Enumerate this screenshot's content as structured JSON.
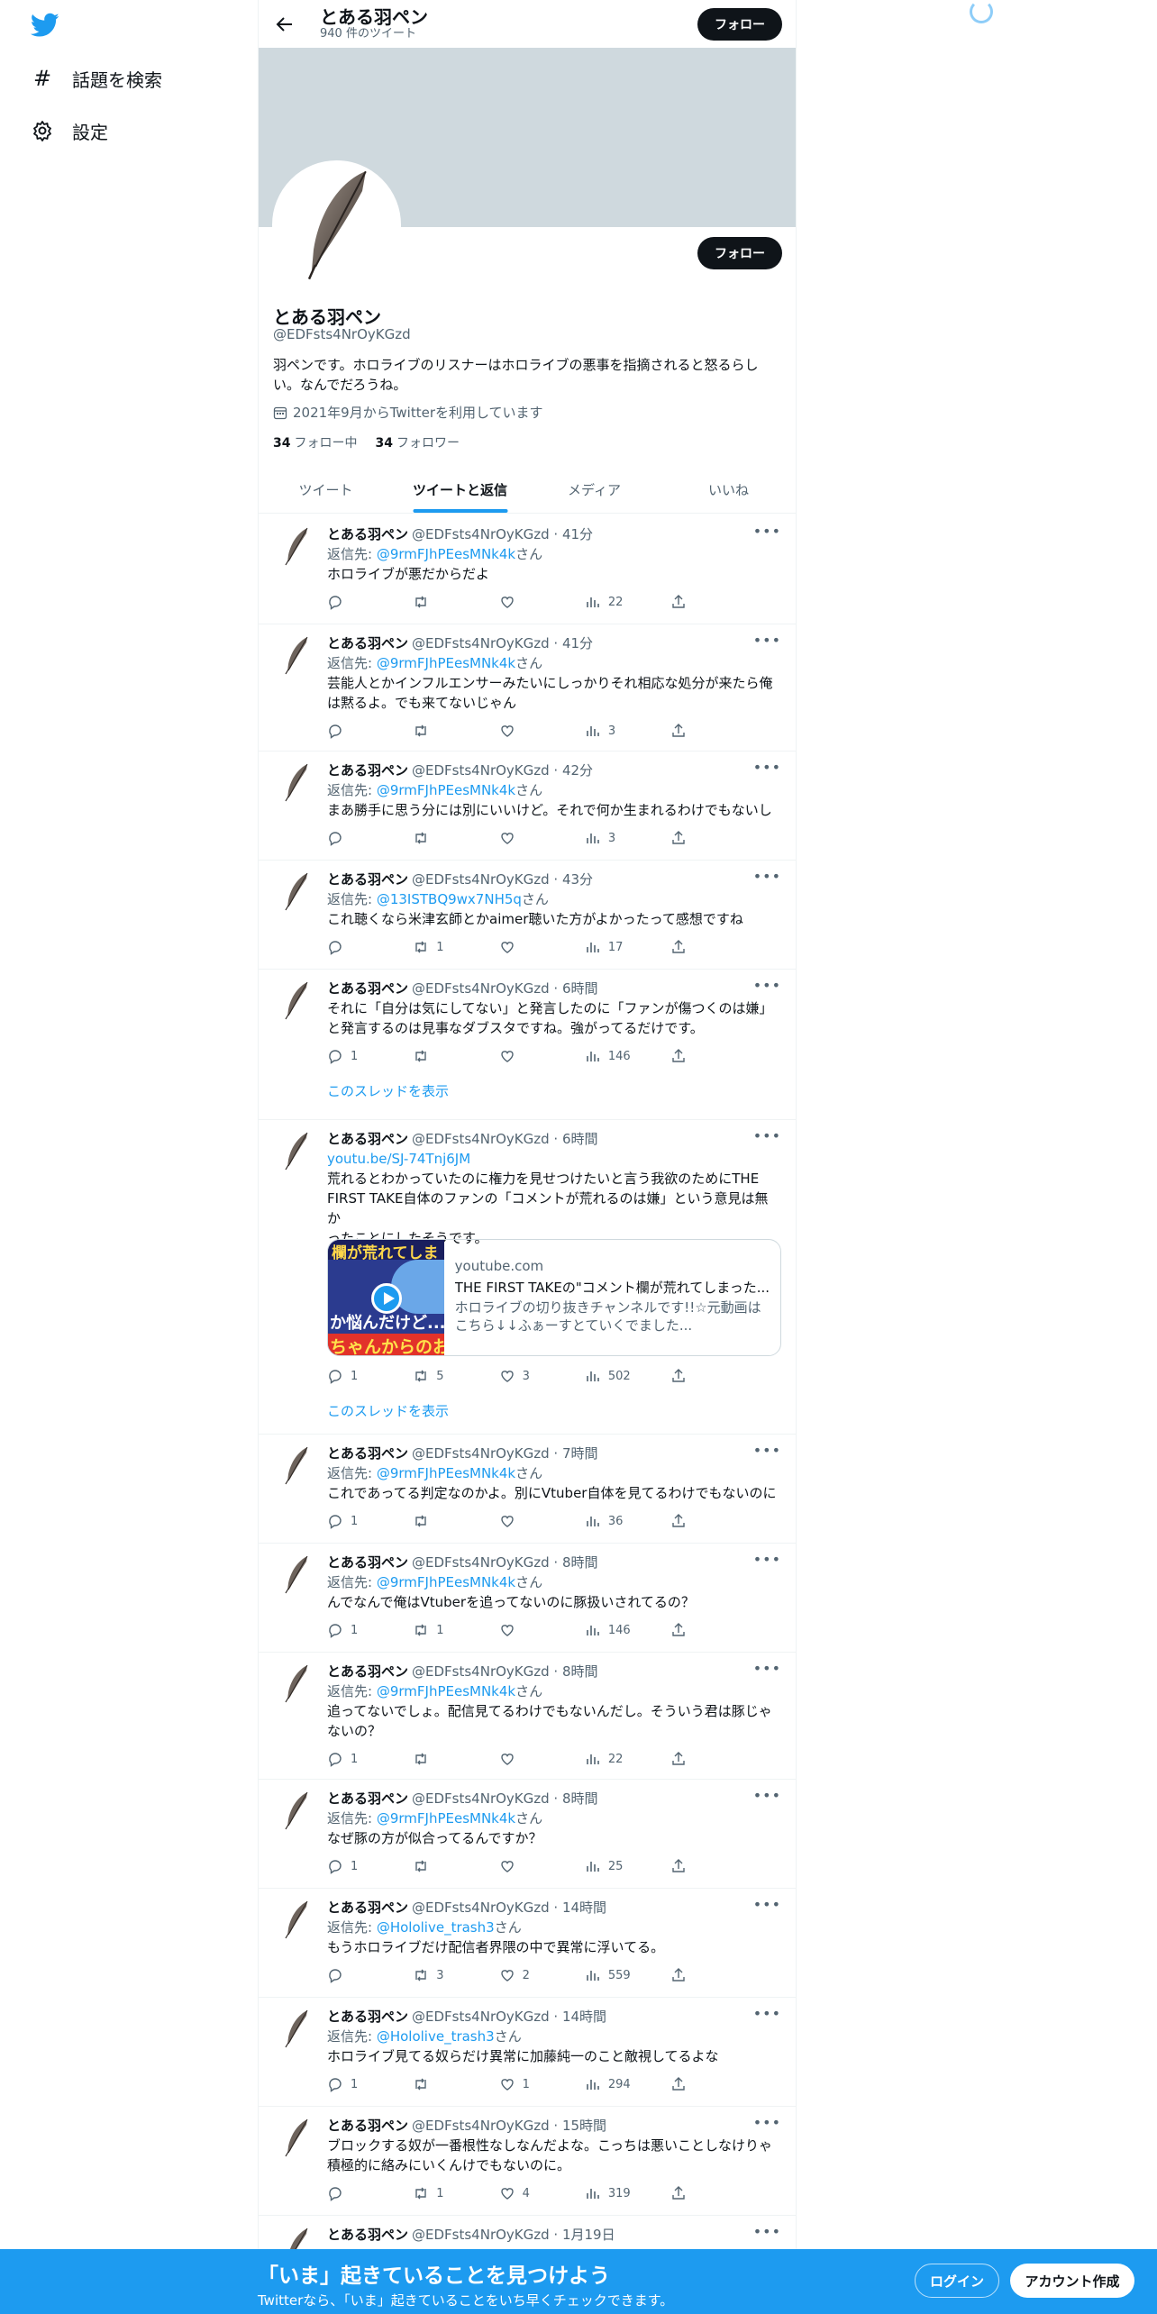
{
  "nav": {
    "explore_label": "話題を検索",
    "settings_label": "設定"
  },
  "header": {
    "title": "とある羽ペン",
    "subtitle": "940 件のツイート",
    "follow_label": "フォロー"
  },
  "profile": {
    "name": "とある羽ペン",
    "handle": "@EDFsts4NrOyKGzd",
    "bio_line1": "羽ペンです。ホロライブのリスナーはホロライブの悪事を指摘されると怒るらし",
    "bio_line2": "い。なんでだろうね。",
    "joined": "2021年9月からTwitterを利用しています",
    "following_count": "34",
    "following_label": "フォロー中",
    "followers_count": "34",
    "followers_label": "フォロワー",
    "follow_label": "フォロー"
  },
  "tabs": [
    "ツイート",
    "ツイートと返信",
    "メディア",
    "いいね"
  ],
  "tweets": [
    {
      "name": "とある羽ペン",
      "meta": "@EDFsts4NrOyKGzd · 41分",
      "reply_prefix": "返信先: ",
      "reply_to": "@9rmFJhPEesMNk4k",
      "reply_suffix": "さん",
      "line1": "ホロライブが悪だからだよ",
      "line2": "",
      "replies": "",
      "retweets": "",
      "likes": "",
      "views": "22"
    },
    {
      "name": "とある羽ペン",
      "meta": "@EDFsts4NrOyKGzd · 41分",
      "reply_prefix": "返信先: ",
      "reply_to": "@9rmFJhPEesMNk4k",
      "reply_suffix": "さん",
      "line1": "芸能人とかインフルエンサーみたいにしっかりそれ相応な処分が来たら俺",
      "line2": "は黙るよ。でも来てないじゃん",
      "replies": "",
      "retweets": "",
      "likes": "",
      "views": "3"
    },
    {
      "name": "とある羽ペン",
      "meta": "@EDFsts4NrOyKGzd · 42分",
      "reply_prefix": "返信先: ",
      "reply_to": "@9rmFJhPEesMNk4k",
      "reply_suffix": "さん",
      "line1": "まあ勝手に思う分には別にいいけど。それで何か生まれるわけでもないし",
      "line2": "",
      "replies": "",
      "retweets": "",
      "likes": "",
      "views": "3"
    },
    {
      "name": "とある羽ペン",
      "meta": "@EDFsts4NrOyKGzd · 43分",
      "reply_prefix": "返信先: ",
      "reply_to": "@13ISTBQ9wx7NH5q",
      "reply_suffix": "さん",
      "line1": "これ聴くなら米津玄師とかaimer聴いた方がよかったって感想ですね",
      "line2": "",
      "replies": "",
      "retweets": "1",
      "likes": "",
      "views": "17"
    },
    {
      "name": "とある羽ペン",
      "meta": "@EDFsts4NrOyKGzd · 6時間",
      "line1": "それに「自分は気にしてない」と発言したのに「ファンが傷つくのは嫌」",
      "line2": "と発言するのは見事なダブスタですね。強がってるだけです。",
      "replies": "1",
      "retweets": "",
      "likes": "",
      "views": "146",
      "thread": "このスレッドを表示"
    },
    {
      "name": "とある羽ペン",
      "meta": "@EDFsts4NrOyKGzd · 6時間",
      "link": "youtu.be/SJ-74Tnj6JM",
      "line1": "荒れるとわかっていたのに権力を見せつけたいと言う我欲のためにTHE",
      "line2": "FIRST TAKE自体のファンの「コメントが荒れるのは嫌」という意見は無か",
      "line3": "ったことにしたそうです。",
      "replies": "1",
      "retweets": "5",
      "likes": "3",
      "views": "502",
      "thread": "このスレッドを表示",
      "card": {
        "domain": "youtube.com",
        "title": "THE FIRST TAKEの\"コメント欄が荒れてしまった...",
        "desc1": "ホロライブの切り抜きチャンネルです!!☆元動画は",
        "desc2": "こちら↓↓ふぁーすとていくでました...",
        "thumb_top": "欄が荒れてしま",
        "thumb_mid": "か悩んだけど...",
        "thumb_bot": "ちゃんからのお"
      }
    },
    {
      "name": "とある羽ペン",
      "meta": "@EDFsts4NrOyKGzd · 7時間",
      "reply_prefix": "返信先: ",
      "reply_to": "@9rmFJhPEesMNk4k",
      "reply_suffix": "さん",
      "line1": "これであってる判定なのかよ。別にVtuber自体を見てるわけでもないのに",
      "line2": "",
      "replies": "1",
      "retweets": "",
      "likes": "",
      "views": "36"
    },
    {
      "name": "とある羽ペン",
      "meta": "@EDFsts4NrOyKGzd · 8時間",
      "reply_prefix": "返信先: ",
      "reply_to": "@9rmFJhPEesMNk4k",
      "reply_suffix": "さん",
      "line1": "んでなんで俺はVtuberを追ってないのに豚扱いされてるの？",
      "line2": "",
      "replies": "1",
      "retweets": "1",
      "likes": "",
      "views": "146"
    },
    {
      "name": "とある羽ペン",
      "meta": "@EDFsts4NrOyKGzd · 8時間",
      "reply_prefix": "返信先: ",
      "reply_to": "@9rmFJhPEesMNk4k",
      "reply_suffix": "さん",
      "line1": "追ってないでしょ。配信見てるわけでもないんだし。そういう君は豚じゃ",
      "line2": "ないの？",
      "replies": "1",
      "retweets": "",
      "likes": "",
      "views": "22"
    },
    {
      "name": "とある羽ペン",
      "meta": "@EDFsts4NrOyKGzd · 8時間",
      "reply_prefix": "返信先: ",
      "reply_to": "@9rmFJhPEesMNk4k",
      "reply_suffix": "さん",
      "line1": "なぜ豚の方が似合ってるんですか？",
      "line2": "",
      "replies": "1",
      "retweets": "",
      "likes": "",
      "views": "25"
    },
    {
      "name": "とある羽ペン",
      "meta": "@EDFsts4NrOyKGzd · 14時間",
      "reply_prefix": "返信先: ",
      "reply_to": "@Hololive_trash3",
      "reply_suffix": "さん",
      "line1": "もうホロライブだけ配信者界隈の中で異常に浮いてる。",
      "line2": "",
      "replies": "",
      "retweets": "3",
      "likes": "2",
      "views": "559"
    },
    {
      "name": "とある羽ペン",
      "meta": "@EDFsts4NrOyKGzd · 14時間",
      "reply_prefix": "返信先: ",
      "reply_to": "@Hololive_trash3",
      "reply_suffix": "さん",
      "line1": "ホロライブ見てる奴らだけ異常に加藤純一のこと敵視してるよな",
      "line2": "",
      "replies": "1",
      "retweets": "",
      "likes": "1",
      "views": "294"
    },
    {
      "name": "とある羽ペン",
      "meta": "@EDFsts4NrOyKGzd · 15時間",
      "line1": "ブロックする奴が一番根性なしなんだよな。こっちは悪いことしなけりゃ",
      "line2": "積極的に絡みにいくんけでもないのに。",
      "replies": "",
      "retweets": "1",
      "likes": "4",
      "views": "319"
    },
    {
      "name": "とある羽ペン",
      "meta": "@EDFsts4NrOyKGzd · 1月19日"
    }
  ],
  "bottom": {
    "title": "「いま」起きていることを見つけよう",
    "subtitle": "Twitterなら、「いま」起きていることをいち早くチェックできます。",
    "login_label": "ログイン",
    "signup_label": "アカウント作成"
  },
  "colors": {
    "accent": "#1d9bf0",
    "text": "#0f1419",
    "muted": "#536471",
    "banner": "#cfd9de"
  }
}
